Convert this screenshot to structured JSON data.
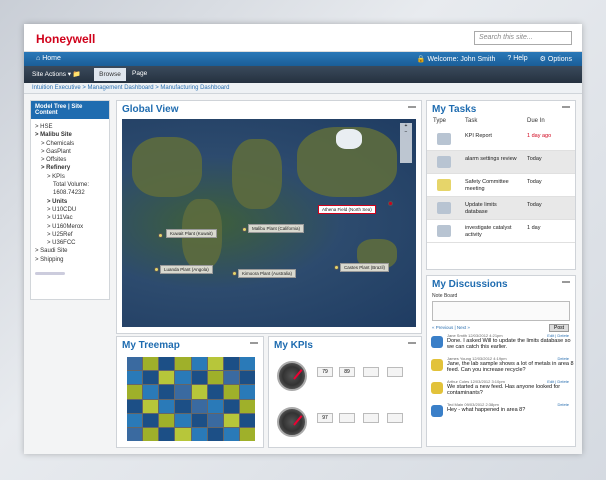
{
  "header": {
    "logo": "Honeywell",
    "search_placeholder": "Search this site..."
  },
  "homebar": {
    "home": "Home",
    "welcome": "Welcome: John Smith",
    "help": "Help",
    "options": "Options"
  },
  "actionbar": {
    "site_actions": "Site Actions",
    "browse": "Browse",
    "page": "Page"
  },
  "breadcrumb": "Intuition Executive  >  Management Dashboard  >  Manufacturing Dashboard",
  "sidebar": {
    "header": "Model Tree  |  Site Content",
    "items": [
      "> HSE",
      "> Malibu Site",
      "> Chemicals",
      "> GasPlant",
      "> Offsites",
      "> Refinery",
      "> KPIs",
      "Total Volume:",
      "1608.74232",
      "> Units",
      "> U10CDU",
      "> U11Vac",
      "> U160Merox",
      "> U25Ref",
      "> U36FCC",
      "> Saudi Site",
      "> Shipping"
    ]
  },
  "global_view": {
    "title": "Global View",
    "labels": [
      "Kuwait Plant (Kuwait)",
      "Malibu Plant (California)",
      "Athena Field (North Sea)",
      "Luanda Plant (Angola)",
      "Kimoora Plant (Australia)",
      "Castes Plant (Brazil)"
    ]
  },
  "tasks": {
    "title": "My Tasks",
    "col_type": "Type",
    "col_task": "Task",
    "col_due": "Due In",
    "rows": [
      {
        "task": "KPI Report",
        "due": "1 day ago"
      },
      {
        "task": "alarm settings review",
        "due": "Today"
      },
      {
        "task": "Safety Committee meeting",
        "due": "Today"
      },
      {
        "task": "Update limits database",
        "due": "Today"
      },
      {
        "task": "investigate catalyst activity",
        "due": "1 day"
      }
    ]
  },
  "discussions": {
    "title": "My Discussions",
    "note_label": "Note Board",
    "post": "Post",
    "pager": "« Previous  |  Next »",
    "messages": [
      {
        "meta": "Jane Smith  12/03/2012 4:21pm",
        "actions": "Edit  |  Delete",
        "text": "Done. I asked Will to update the limits database so we can catch this earlier."
      },
      {
        "meta": "James Young  12/03/2012 4:19pm",
        "actions": "Delete",
        "text": "Jane, the lab sample shows a lot of metals in area 8 feed. Can you increase recycle?"
      },
      {
        "meta": "Arthur Coles  12/03/2012 3:10pm",
        "actions": "Edit  |  Delete",
        "text": "We started a new feed. Has anyone looked for contaminants?"
      },
      {
        "meta": "Ted Main  09/03/2012 2:38pm",
        "actions": "Delete",
        "text": "Hey - what happened in area 8?"
      }
    ]
  },
  "treemap": {
    "title": "My Treemap"
  },
  "kpis": {
    "title": "My KPIs",
    "rows": [
      {
        "values": [
          "79",
          "89",
          "",
          ""
        ]
      },
      {
        "values": [
          "97",
          "",
          "",
          ""
        ]
      }
    ]
  }
}
